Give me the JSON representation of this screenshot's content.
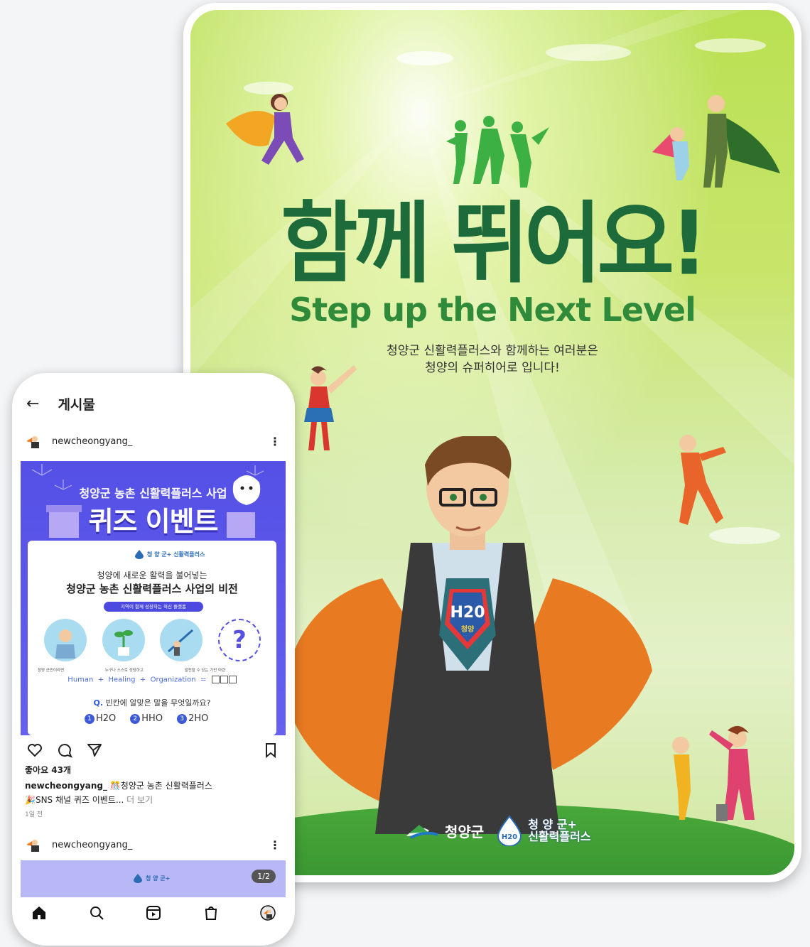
{
  "poster": {
    "headline": "함께 뛰어요!",
    "subheadline": "Step up the Next Level",
    "description_line1": "청양군 신활력플러스와 함께하는 여러분은",
    "description_line2": "청양의 슈퍼히어로 입니다!",
    "hero_emblem": "H20",
    "hero_emblem_sub": "청양",
    "logo_county": "청양군",
    "logo_h2o_badge": "H20",
    "logo_h2o_line1": "청 양 군+",
    "logo_h2o_line2": "신활력플러스"
  },
  "phone": {
    "header": {
      "title": "게시물"
    },
    "post1": {
      "username": "newcheongyang_",
      "banner_title": "청양군 농촌 신활력플러스 사업",
      "banner_big": "퀴즈 이벤트",
      "card_logo": "청 양 군+ 신활력플러스",
      "card_line1": "청양에 새로운 활력을 불어넣는",
      "card_line2": "청양군 농촌 신활력플러스 사업의 비전",
      "card_pill": "지역이 함께 성장하는 혁신 플랫폼",
      "captions": [
        "청양 군민이라면",
        "누구나 스스로 성장하고",
        "발전할 수 있는 기반 마련",
        ""
      ],
      "formula": [
        "Human",
        "+",
        "Healing",
        "+",
        "Organization",
        "="
      ],
      "question_q": "Q.",
      "question": "빈칸에 알맞은 말을 무엇일까요?",
      "options": [
        {
          "num": "1",
          "label": "H2O"
        },
        {
          "num": "2",
          "label": "HHO"
        },
        {
          "num": "3",
          "label": "2HO"
        }
      ],
      "likes": "좋아요 43개",
      "caption_user": "newcheongyang_",
      "caption_text": "청양군 농촌 신활력플러스",
      "caption_text2": "SNS 채널 퀴즈 이벤트...",
      "caption_more": "더 보기",
      "time": "1일 전"
    },
    "post2": {
      "username": "newcheongyang_",
      "pager": "1/2",
      "logo": "청 양 군+"
    },
    "colors": {
      "post_bg": "#5650e6",
      "poster_title": "#1d6b3a"
    }
  }
}
